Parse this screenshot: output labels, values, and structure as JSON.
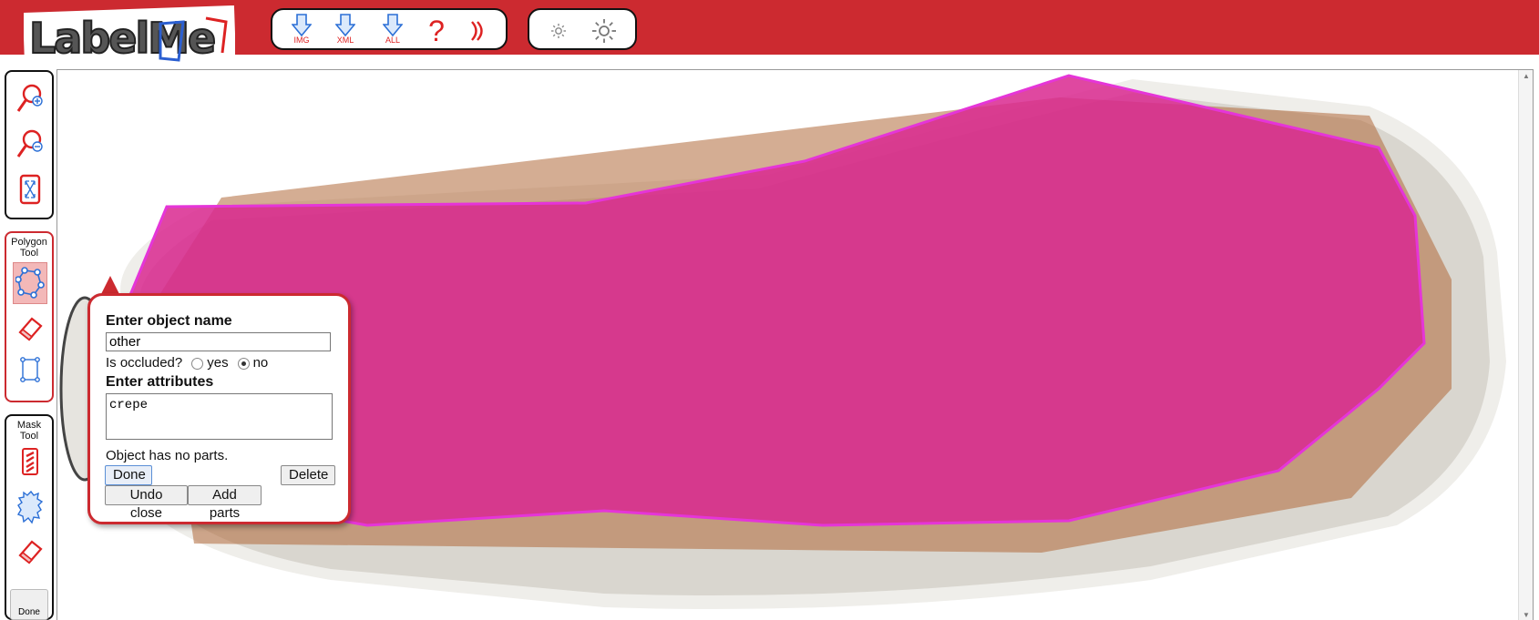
{
  "app": {
    "title": "LabelMe"
  },
  "toolbar": {
    "download_img_label": "IMG",
    "download_xml_label": "XML",
    "download_all_label": "ALL",
    "help_label": "?",
    "accent_color": "#cc2a30"
  },
  "side": {
    "polygon_title_1": "Polygon",
    "polygon_title_2": "Tool",
    "mask_title_1": "Mask",
    "mask_title_2": "Tool",
    "mask_done_label": "Done"
  },
  "popup": {
    "name_heading": "Enter object name",
    "name_value": "other",
    "occluded_label": "Is occluded?",
    "occluded_yes": "yes",
    "occluded_no": "no",
    "occluded_selected": "no",
    "attributes_heading": "Enter attributes",
    "attributes_value": "crepe",
    "parts_text": "Object has no parts.",
    "done_label": "Done",
    "delete_label": "Delete",
    "undo_close_label": "Undo close",
    "add_parts_label": "Add parts"
  },
  "annotation": {
    "fill_color": "#d9288f",
    "stroke_color": "#e535d8"
  }
}
